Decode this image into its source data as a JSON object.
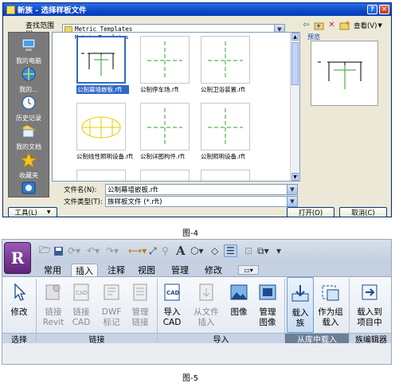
{
  "dialog": {
    "title": "新族 - 选择样板文件",
    "look_in_label": "查找范围(I):",
    "look_in_value": "Metric Templates",
    "view_label": "查看(V)",
    "preview_label": "预览",
    "places": [
      {
        "label": "我的电脑",
        "icon": "computer-icon"
      },
      {
        "label": "我的...",
        "icon": "network-icon"
      },
      {
        "label": "历史记录",
        "icon": "history-icon"
      },
      {
        "label": "我的文档",
        "icon": "documents-icon"
      },
      {
        "label": "收藏夹",
        "icon": "favorites-icon"
      },
      {
        "label": "",
        "icon": "desktop-icon"
      }
    ],
    "files": [
      {
        "name": "公制幕墙嵌板.rft",
        "selected": true
      },
      {
        "name": "公制停车场.rft",
        "selected": false
      },
      {
        "name": "公制卫浴装置.rft",
        "selected": false
      },
      {
        "name": "公制线性照明设备.rft",
        "selected": false
      },
      {
        "name": "公制详图构件.rft",
        "selected": false
      },
      {
        "name": "公制照明设备.rft",
        "selected": false
      }
    ],
    "file_name_label": "文件名(N):",
    "file_name_value": "公制幕墙嵌板.rft",
    "file_type_label": "文件类型(T):",
    "file_type_value": "族样板文件 (*.rft)",
    "tools_label": "工具(L)",
    "open_label": "打开(O)",
    "cancel_label": "取消(C)"
  },
  "caption4": "图-4",
  "ribbon": {
    "app_letter": "R",
    "tabs": [
      "常用",
      "插入",
      "注释",
      "视图",
      "管理",
      "修改"
    ],
    "active_tab": "插入",
    "qat_text_a": "A",
    "tools": [
      {
        "label": "修改",
        "icon": "cursor-icon",
        "enabled": true
      },
      {
        "label": "链接\nRevit",
        "icon": "link-revit-icon",
        "enabled": false
      },
      {
        "label": "链接\nCAD",
        "icon": "link-cad-icon",
        "enabled": false
      },
      {
        "label": "DWF\n标记",
        "icon": "dwf-markup-icon",
        "enabled": false
      },
      {
        "label": "管理\n链接",
        "icon": "manage-links-icon",
        "enabled": false
      },
      {
        "label": "导入\nCAD",
        "icon": "import-cad-icon",
        "enabled": true
      },
      {
        "label": "从文件\n插入",
        "icon": "insert-from-file-icon",
        "enabled": false
      },
      {
        "label": "图像",
        "icon": "image-icon",
        "enabled": true
      },
      {
        "label": "管理\n图像",
        "icon": "manage-images-icon",
        "enabled": true
      },
      {
        "label": "载入\n族",
        "icon": "load-family-icon",
        "enabled": true
      },
      {
        "label": "作为组\n载入",
        "icon": "load-as-group-icon",
        "enabled": true
      },
      {
        "label": "载入到\n项目中",
        "icon": "load-into-project-icon",
        "enabled": true
      }
    ],
    "groups": [
      "选择",
      "链接",
      "导入",
      "从库中载入",
      "族编辑器"
    ]
  },
  "caption5": "图-5"
}
